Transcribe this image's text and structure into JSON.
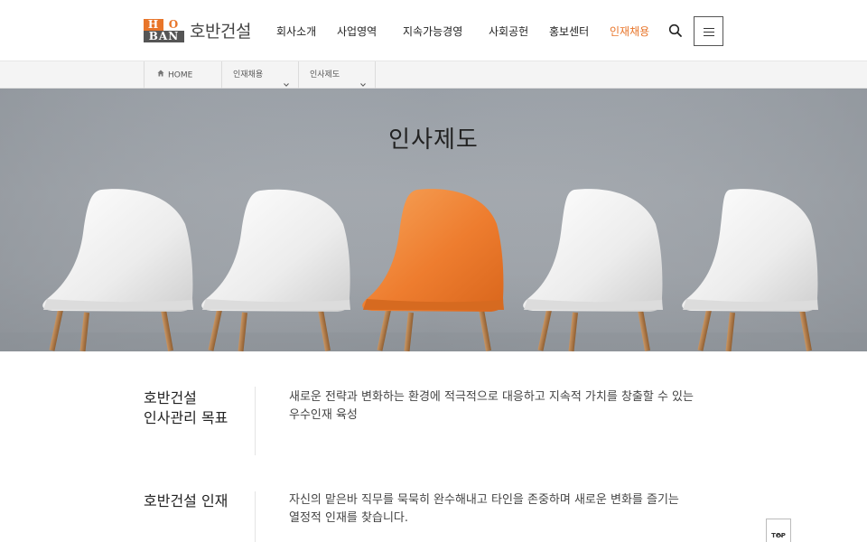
{
  "header": {
    "logo": {
      "mark_top_left": "H",
      "mark_top_right": "O",
      "mark_bottom": "BAN",
      "text": "호반건설"
    },
    "nav": [
      {
        "label": "회사소개"
      },
      {
        "label": "사업영역"
      },
      {
        "label": "지속가능경영"
      },
      {
        "label": "사회공헌"
      },
      {
        "label": "홍보센터"
      },
      {
        "label": "인재채용",
        "active": true
      }
    ],
    "search_icon": "search-icon",
    "menu_icon": "hamburger-icon"
  },
  "breadcrumb": {
    "home": "HOME",
    "level1": "인재채용",
    "level2": "인사제도"
  },
  "hero": {
    "title": "인사제도"
  },
  "sections": [
    {
      "heading_line1": "호반건설",
      "heading_line2": "인사관리 목표",
      "body_line1": "새로운 전략과 변화하는 환경에 적극적으로 대응하고 지속적 가치를 창출할 수 있는",
      "body_line2": "우수인재 육성"
    },
    {
      "heading_line1": "호반건설 인재",
      "body_line1": "자신의 맡은바 직무를 묵묵히 완수해내고 타인을 존중하며 새로운 변화를 즐기는",
      "body_line2": "열정적 인재를 찾습니다."
    }
  ],
  "top_button": {
    "label": "TOP"
  },
  "colors": {
    "accent": "#e8752a",
    "text": "#222222",
    "hero_bg": "#9ea3a9",
    "chair_white": "#f2f2f2",
    "chair_orange": "#ee7d2f"
  }
}
